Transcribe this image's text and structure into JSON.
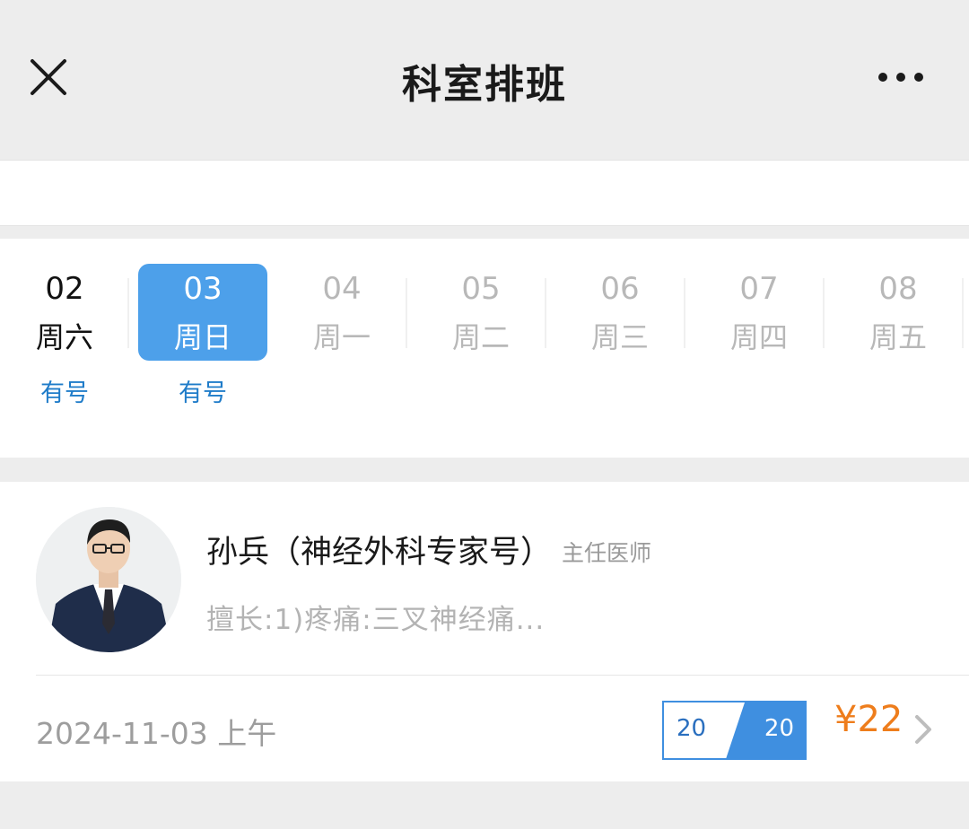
{
  "header": {
    "title": "科室排班",
    "close_icon": "close-icon",
    "more_icon": "more-icon"
  },
  "dates": [
    {
      "day": "02",
      "weekday": "周六",
      "status": "有号",
      "state": "past"
    },
    {
      "day": "03",
      "weekday": "周日",
      "status": "有号",
      "state": "selected"
    },
    {
      "day": "04",
      "weekday": "周一",
      "status": "",
      "state": "muted"
    },
    {
      "day": "05",
      "weekday": "周二",
      "status": "",
      "state": "muted"
    },
    {
      "day": "06",
      "weekday": "周三",
      "status": "",
      "state": "muted"
    },
    {
      "day": "07",
      "weekday": "周四",
      "status": "",
      "state": "muted"
    },
    {
      "day": "08",
      "weekday": "周五",
      "status": "",
      "state": "muted"
    }
  ],
  "doctor": {
    "name": "孙兵（神经外科专家号）",
    "title": "主任医师",
    "specialty": "擅长:1)疼痛:三叉神经痛...",
    "avatar_icon": "doctor-avatar"
  },
  "slot": {
    "date": "2024-11-03 上午",
    "remaining": "20",
    "total": "20",
    "price": "¥22",
    "chevron_icon": "chevron-right-icon"
  },
  "colors": {
    "accent": "#4da0ea",
    "available_text": "#1f7cc9",
    "price": "#ee7d1c",
    "quota_border": "#3f8fe0"
  }
}
